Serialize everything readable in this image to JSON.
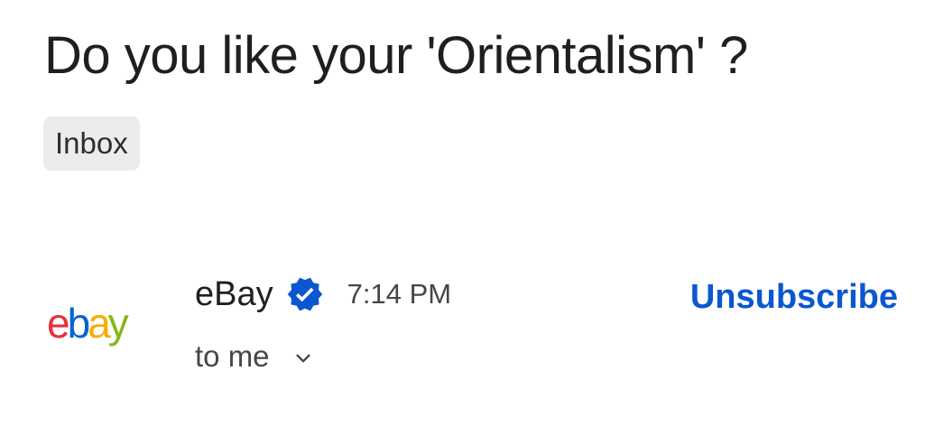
{
  "email": {
    "subject": "Do you like your 'Orientalism' ?",
    "label": "Inbox"
  },
  "sender": {
    "avatar_logo": {
      "e": "e",
      "b": "b",
      "a": "a",
      "y": "y"
    },
    "name": "eBay",
    "verified_icon": "verified-badge-icon",
    "time": "7:14 PM",
    "recipient": "to me",
    "expand_icon": "chevron-down-icon"
  },
  "actions": {
    "unsubscribe": "Unsubscribe"
  },
  "colors": {
    "text_primary": "#1f1f1f",
    "text_secondary": "#444746",
    "link_blue": "#0b57d0",
    "verified_blue": "#0b57d0",
    "chip_bg": "#ececec",
    "ebay_red": "#e53238",
    "ebay_blue": "#0064d2",
    "ebay_yellow": "#f5af02",
    "ebay_green": "#86b817"
  }
}
